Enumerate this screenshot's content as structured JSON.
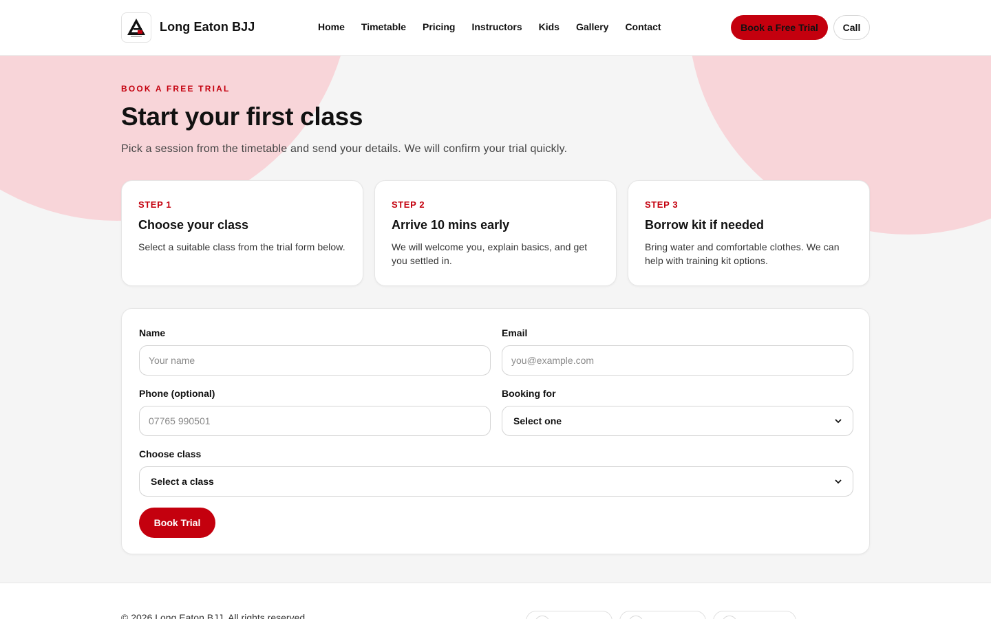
{
  "header": {
    "brand": "Long Eaton BJJ",
    "nav": [
      "Home",
      "Timetable",
      "Pricing",
      "Instructors",
      "Kids",
      "Gallery",
      "Contact"
    ],
    "cta_trial": "Book a Free Trial",
    "cta_call": "Call"
  },
  "hero": {
    "eyebrow": "BOOK A FREE TRIAL",
    "title": "Start your first class",
    "subtitle": "Pick a session from the timetable and send your details. We will confirm your trial quickly."
  },
  "steps": [
    {
      "label": "STEP 1",
      "title": "Choose your class",
      "desc": "Select a suitable class from the trial form below."
    },
    {
      "label": "STEP 2",
      "title": "Arrive 10 mins early",
      "desc": "We will welcome you, explain basics, and get you settled in."
    },
    {
      "label": "STEP 3",
      "title": "Borrow kit if needed",
      "desc": "Bring water and comfortable clothes. We can help with training kit options."
    }
  ],
  "form": {
    "name_label": "Name",
    "name_placeholder": "Your name",
    "email_label": "Email",
    "email_placeholder": "you@example.com",
    "phone_label": "Phone (optional)",
    "phone_placeholder": "07765 990501",
    "booking_label": "Booking for",
    "booking_value": "Select one",
    "class_label": "Choose class",
    "class_value": "Select a class",
    "submit": "Book Trial"
  },
  "footer": {
    "copyright": "© 2026 Long Eaton BJJ. All rights reserved."
  },
  "colors": {
    "accent": "#c4000e",
    "blob": "#f8d5d9",
    "page_bg": "#f5f5f5"
  }
}
